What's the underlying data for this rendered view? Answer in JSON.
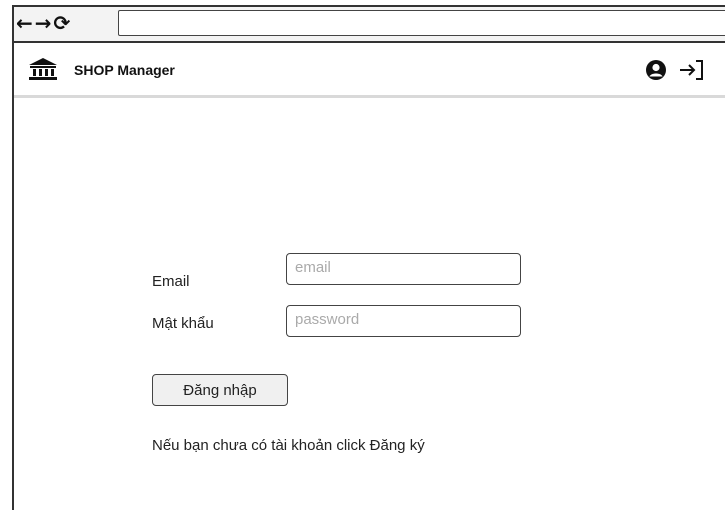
{
  "browser": {
    "back_icon": "←",
    "forward_icon": "→",
    "reload_icon": "⟳",
    "url": ""
  },
  "header": {
    "logo_icon": "bank-icon",
    "title": "SHOP Manager",
    "user_icon": "user-circle-icon",
    "logout_icon": "sign-out-icon"
  },
  "login_form": {
    "email_label": "Email",
    "email_placeholder": "email",
    "email_value": "",
    "password_label": "Mật khẩu",
    "password_placeholder": "password",
    "password_value": "",
    "submit_label": "Đăng nhập",
    "register_note": "Nếu bạn chưa có tài khoản click Đăng ký"
  }
}
